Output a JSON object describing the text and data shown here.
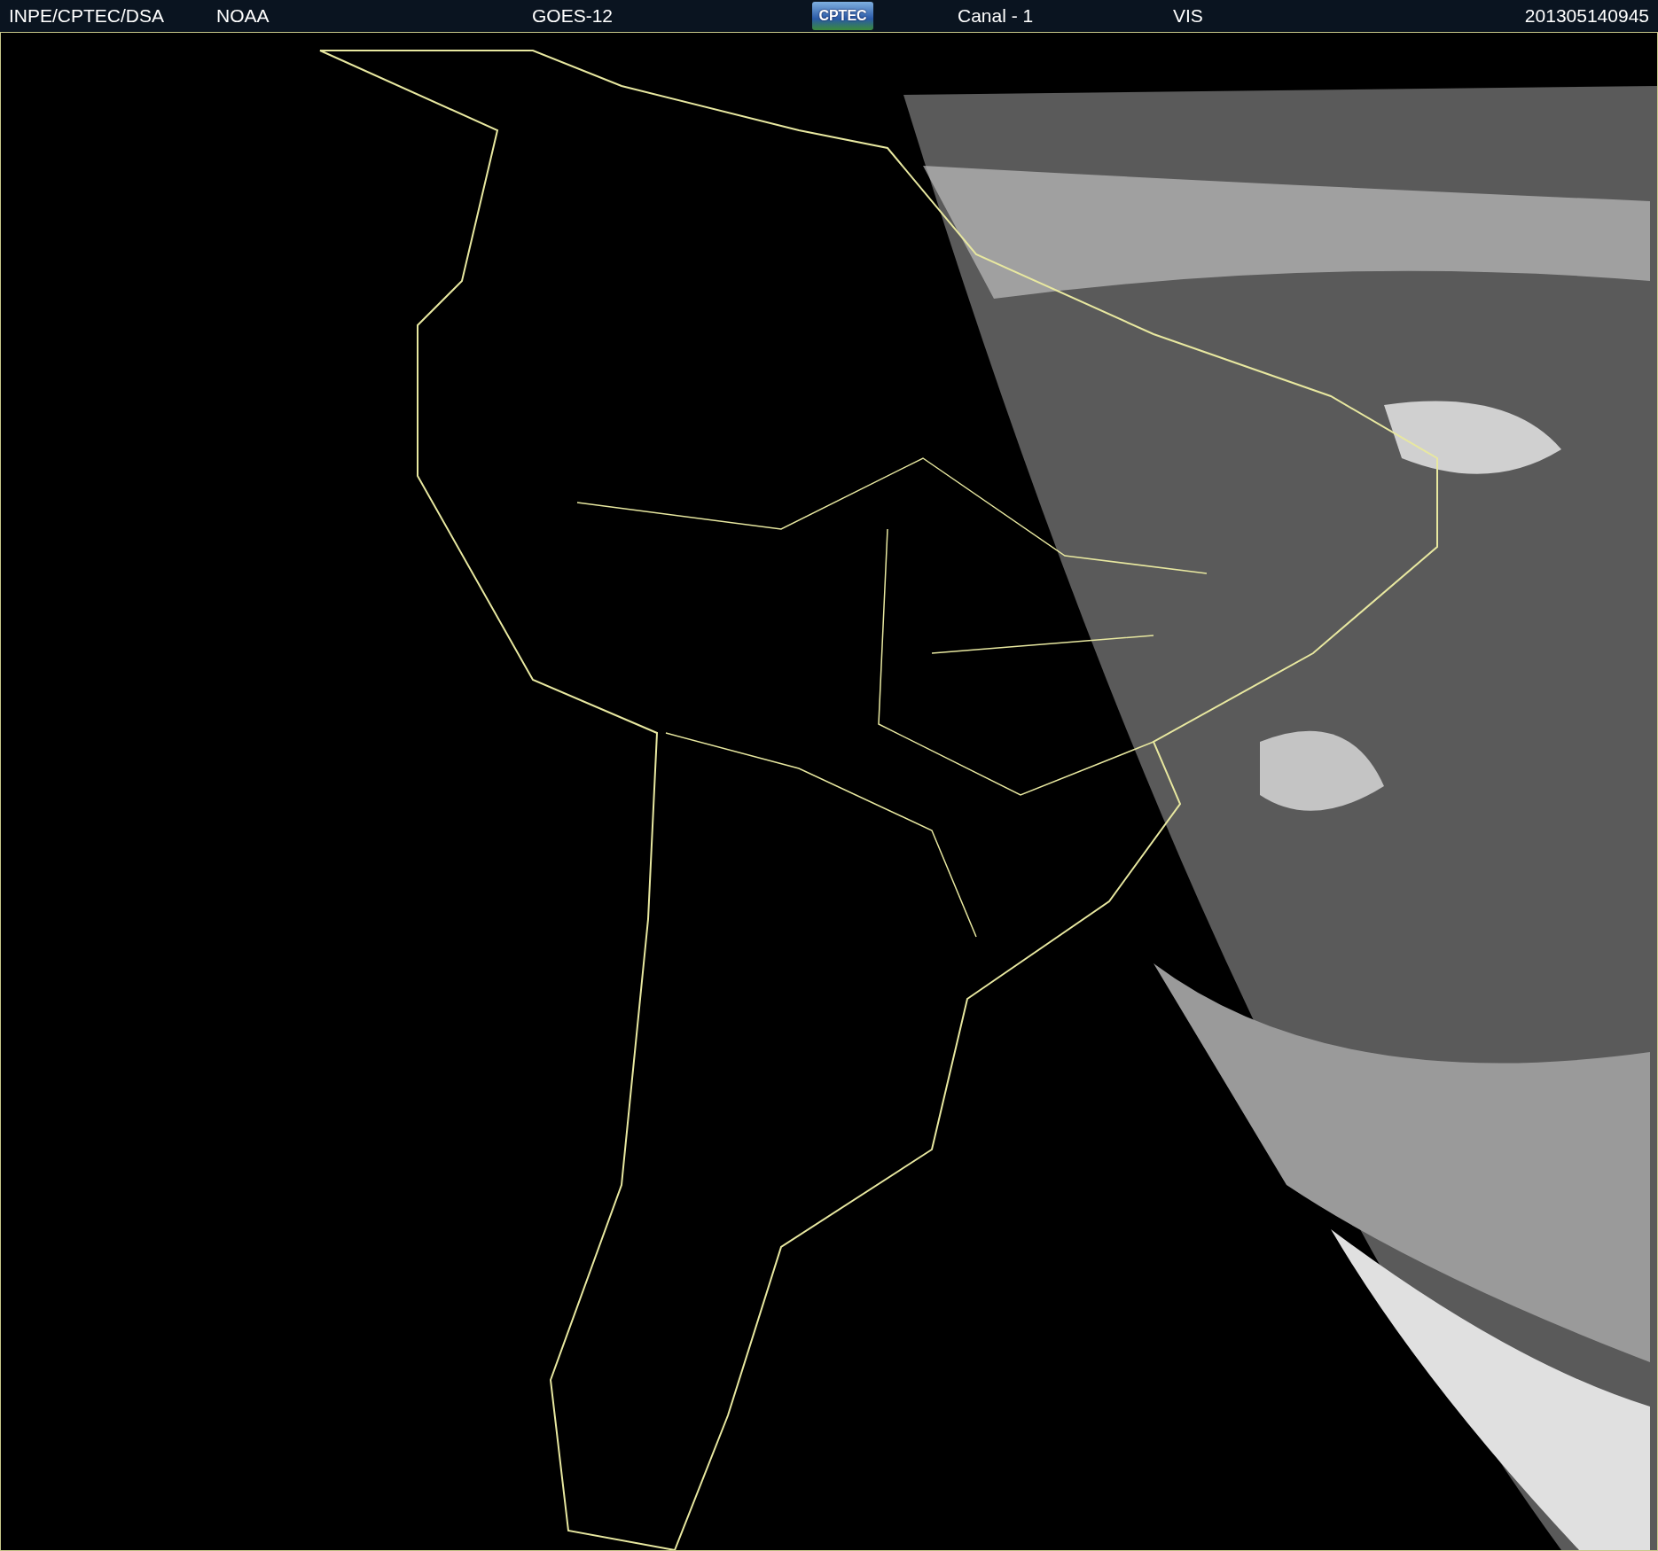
{
  "header": {
    "items": [
      {
        "kind": "text",
        "label": "INPE/CPTEC/DSA"
      },
      {
        "kind": "text",
        "label": "NOAA"
      },
      {
        "kind": "text",
        "label": "GOES-12"
      },
      {
        "kind": "logo",
        "label": "CPTEC"
      },
      {
        "kind": "text",
        "label": "Canal - 1"
      },
      {
        "kind": "text",
        "label": "VIS"
      },
      {
        "kind": "text",
        "label": "201305140945"
      }
    ]
  }
}
